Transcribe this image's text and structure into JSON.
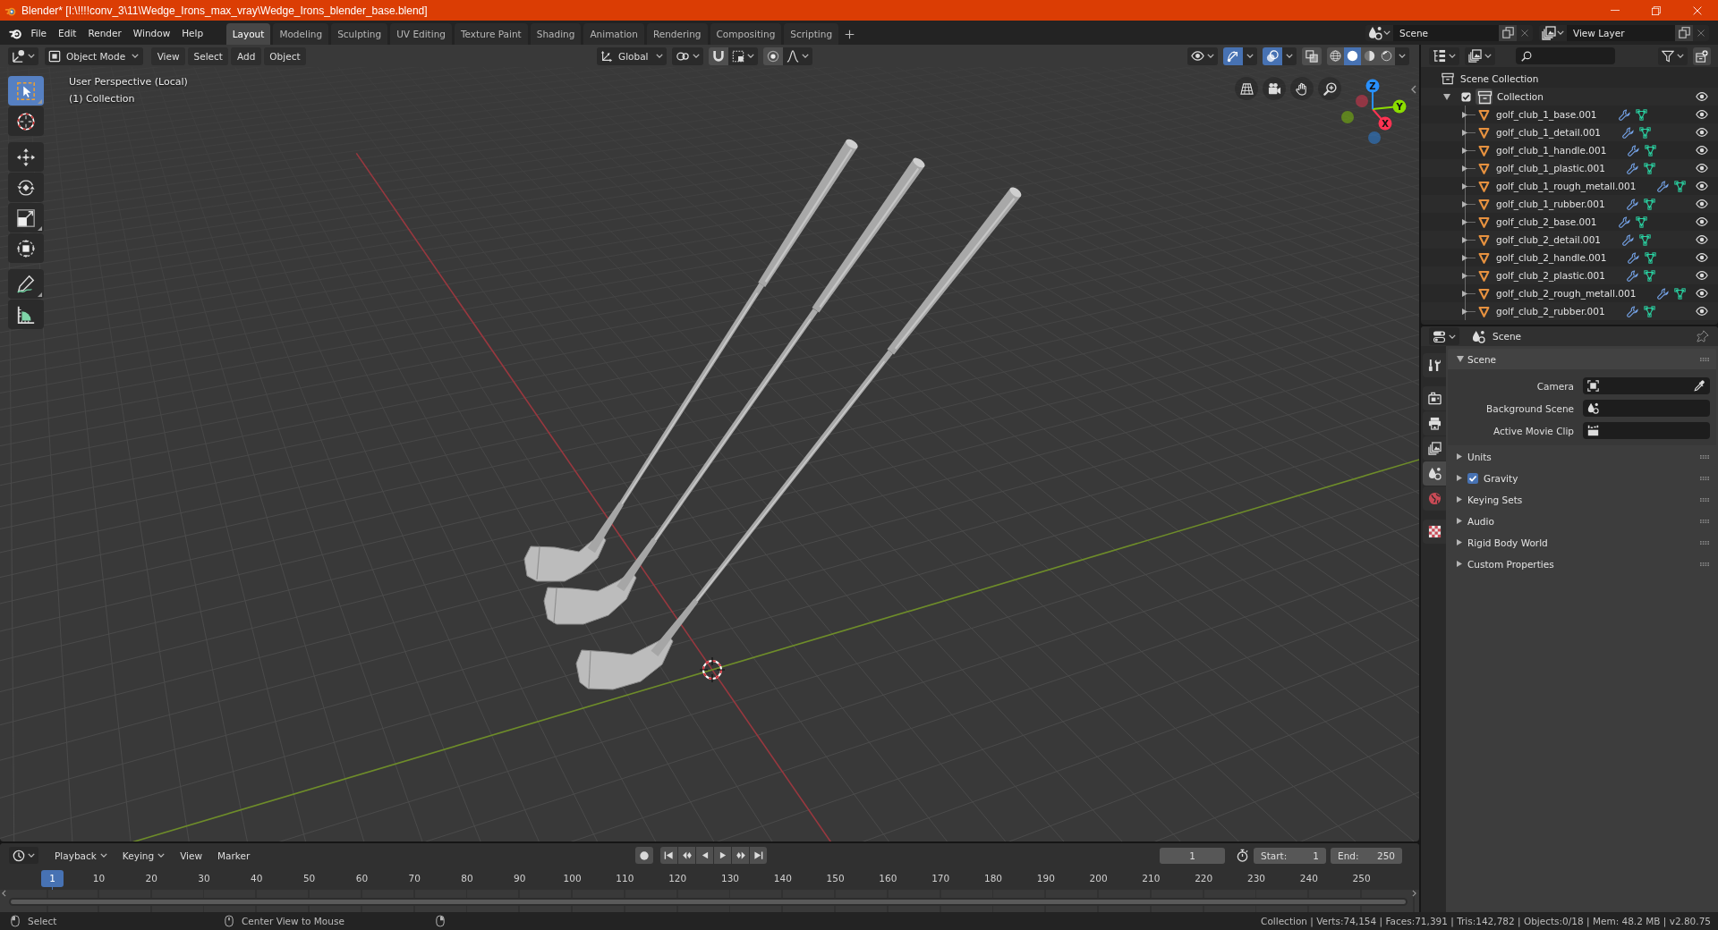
{
  "window": {
    "title": "Blender* [I:\\!!!!conv_3\\11\\Wedge_Irons_max_vray\\Wedge_Irons_blender_base.blend]"
  },
  "menu": [
    "File",
    "Edit",
    "Render",
    "Window",
    "Help"
  ],
  "workspaces": [
    {
      "label": "Layout",
      "selected": true
    },
    {
      "label": "Modeling",
      "selected": false
    },
    {
      "label": "Sculpting",
      "selected": false
    },
    {
      "label": "UV Editing",
      "selected": false
    },
    {
      "label": "Texture Paint",
      "selected": false
    },
    {
      "label": "Shading",
      "selected": false
    },
    {
      "label": "Animation",
      "selected": false
    },
    {
      "label": "Rendering",
      "selected": false
    },
    {
      "label": "Compositing",
      "selected": false
    },
    {
      "label": "Scripting",
      "selected": false
    }
  ],
  "scene": {
    "value": "Scene"
  },
  "view_layer": {
    "value": "View Layer"
  },
  "viewport": {
    "mode": "Object Mode",
    "menus": [
      "View",
      "Select",
      "Add",
      "Object"
    ],
    "orientation": "Global",
    "toggles": [
      {
        "kind": "snap",
        "on": false
      },
      {
        "kind": "proportional",
        "on": false
      },
      {
        "kind": "gizmos",
        "on": true
      },
      {
        "kind": "overlays",
        "on": true
      },
      {
        "kind": "xray",
        "on": false
      }
    ],
    "shading": [
      {
        "kind": "wireframe",
        "selected": false
      },
      {
        "kind": "solid",
        "selected": true
      },
      {
        "kind": "material",
        "selected": false
      },
      {
        "kind": "rendered",
        "selected": false
      }
    ],
    "tool_groups": [
      {
        "tools": [
          {
            "kind": "select_box",
            "selected": true
          },
          {
            "kind": "cursor",
            "selected": false
          }
        ]
      },
      {
        "tools": [
          {
            "kind": "move",
            "selected": false
          },
          {
            "kind": "rotate",
            "selected": false
          },
          {
            "kind": "scale",
            "selected": false
          },
          {
            "kind": "transform",
            "selected": false
          }
        ]
      },
      {
        "tools": [
          {
            "kind": "annotate",
            "selected": false
          },
          {
            "kind": "measure",
            "selected": false
          }
        ]
      }
    ],
    "info": [
      "User Perspective (Local)",
      "(1) Collection"
    ],
    "axes": [
      {
        "label": "X",
        "color": "#ff3352"
      },
      {
        "label": "Y",
        "color": "#8bdc00"
      },
      {
        "label": "Z",
        "color": "#2890ff"
      }
    ]
  },
  "outliner": {
    "root": "Scene Collection",
    "collection": {
      "name": "Collection",
      "checked": true,
      "expanded": true,
      "visible": true,
      "children": [
        {
          "name": "golf_club_1_base.001",
          "expanded": false,
          "visible": true
        },
        {
          "name": "golf_club_1_detail.001",
          "expanded": false,
          "visible": true
        },
        {
          "name": "golf_club_1_handle.001",
          "expanded": false,
          "visible": true
        },
        {
          "name": "golf_club_1_plastic.001",
          "expanded": false,
          "visible": true
        },
        {
          "name": "golf_club_1_rough_metall.001",
          "expanded": false,
          "visible": true
        },
        {
          "name": "golf_club_1_rubber.001",
          "expanded": false,
          "visible": true
        },
        {
          "name": "golf_club_2_base.001",
          "expanded": false,
          "visible": true
        },
        {
          "name": "golf_club_2_detail.001",
          "expanded": false,
          "visible": true
        },
        {
          "name": "golf_club_2_handle.001",
          "expanded": false,
          "visible": true
        },
        {
          "name": "golf_club_2_plastic.001",
          "expanded": false,
          "visible": true
        },
        {
          "name": "golf_club_2_rough_metall.001",
          "expanded": false,
          "visible": true
        },
        {
          "name": "golf_club_2_rubber.001",
          "expanded": false,
          "visible": true
        }
      ]
    }
  },
  "properties": {
    "context": "Scene",
    "tab_groups": [
      {
        "tabs": [
          {
            "kind": "tool",
            "selected": false
          }
        ]
      },
      {
        "tabs": [
          {
            "kind": "render",
            "selected": false
          },
          {
            "kind": "output",
            "selected": false
          },
          {
            "kind": "view_layer",
            "selected": false
          },
          {
            "kind": "scene",
            "selected": true
          },
          {
            "kind": "world",
            "selected": false
          }
        ]
      },
      {
        "tabs": [
          {
            "kind": "texture",
            "selected": false
          }
        ]
      }
    ],
    "panels": [
      {
        "title": "Scene",
        "kind": "plain",
        "expanded": true,
        "fields": [
          {
            "label": "Camera",
            "kind": "camera"
          },
          {
            "label": "Background Scene",
            "kind": "scene"
          },
          {
            "label": "Active Movie Clip",
            "kind": "clip"
          }
        ]
      },
      {
        "title": "Units",
        "kind": "plain",
        "expanded": false
      },
      {
        "title": "Gravity",
        "kind": "toggle",
        "checked": true,
        "expanded": false
      },
      {
        "title": "Keying Sets",
        "kind": "plain",
        "expanded": false
      },
      {
        "title": "Audio",
        "kind": "plain",
        "expanded": false
      },
      {
        "title": "Rigid Body World",
        "kind": "plain",
        "expanded": false
      },
      {
        "title": "Custom Properties",
        "kind": "plain",
        "expanded": false
      }
    ]
  },
  "timeline": {
    "menus": [
      {
        "label": "Playback",
        "kind": "dropdown"
      },
      {
        "label": "Keying",
        "kind": "dropdown"
      },
      {
        "label": "View",
        "kind": "menu"
      },
      {
        "label": "Marker",
        "kind": "menu"
      }
    ],
    "auto_key": false,
    "current_frame": "1",
    "start_label": "Start:",
    "start": "1",
    "end_label": "End:",
    "end": "250",
    "playhead": "1",
    "ruler": [
      "10",
      "20",
      "30",
      "40",
      "50",
      "60",
      "70",
      "80",
      "90",
      "100",
      "110",
      "120",
      "130",
      "140",
      "150",
      "160",
      "170",
      "180",
      "190",
      "200",
      "210",
      "220",
      "230",
      "240",
      "250"
    ]
  },
  "status_bar": {
    "hints": [
      "Select",
      "Center View to Mouse"
    ],
    "stats": "Collection | Verts:74,154 | Faces:71,391 | Tris:142,782 | Objects:0/18 | Mem: 48.2 MB | v2.80.75"
  }
}
